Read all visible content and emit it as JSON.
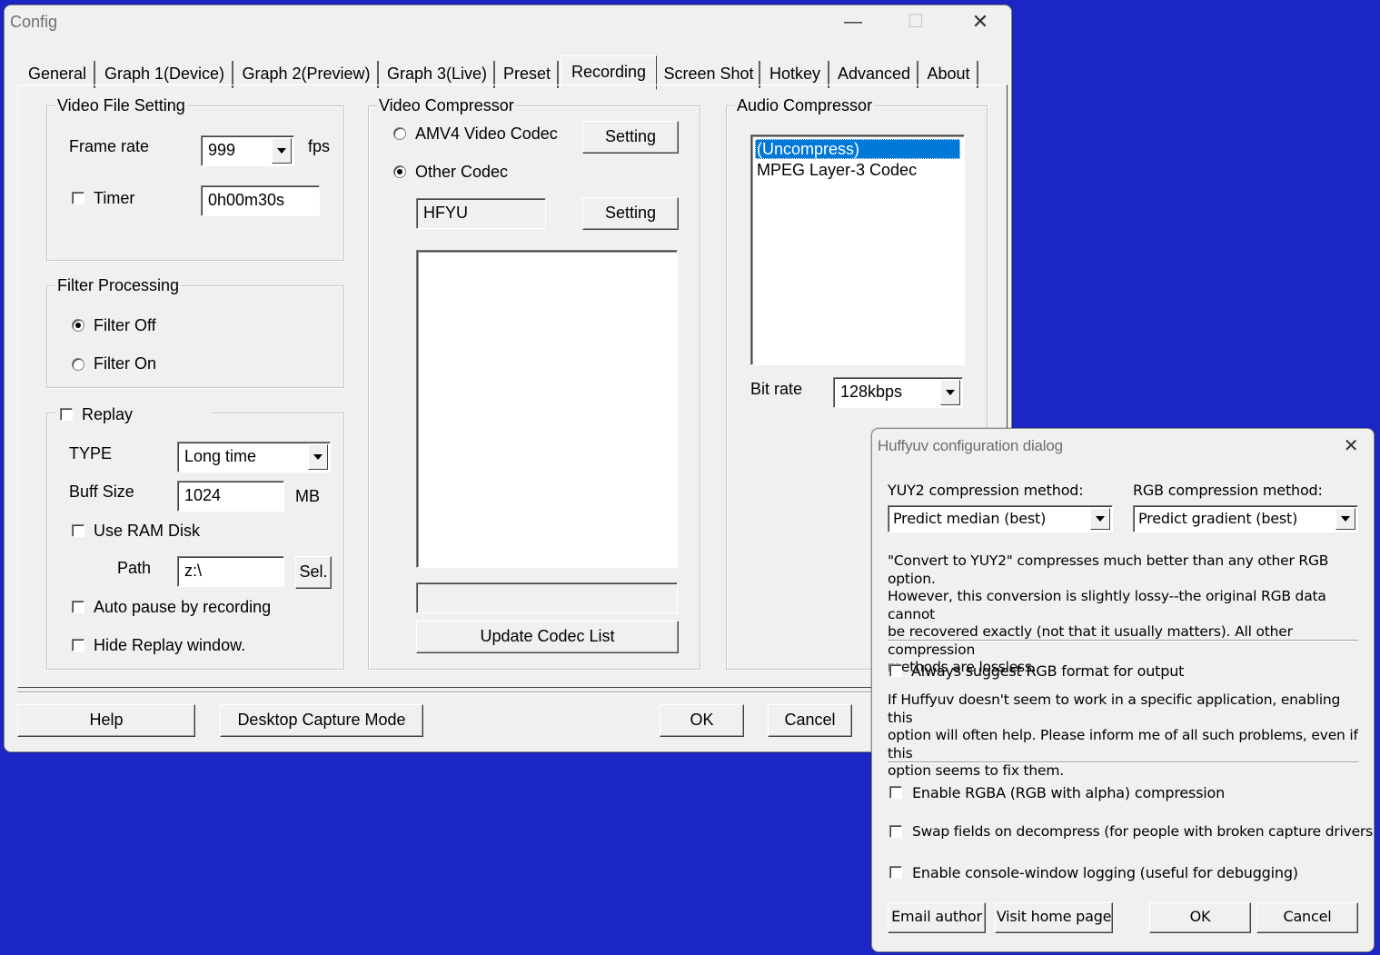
{
  "config": {
    "title": "Config",
    "tabs": [
      "General",
      "Graph 1(Device)",
      "Graph 2(Preview)",
      "Graph 3(Live)",
      "Preset",
      "Recording",
      "Screen Shot",
      "Hotkey",
      "Advanced",
      "About"
    ],
    "active_tab": "Recording",
    "video_file": {
      "legend": "Video File Setting",
      "frame_rate_label": "Frame rate",
      "frame_rate_value": "999",
      "fps_label": "fps",
      "timer_label": "Timer",
      "timer_checked": false,
      "timer_value": "0h00m30s"
    },
    "filter": {
      "legend": "Filter Processing",
      "off_label": "Filter Off",
      "on_label": "Filter On",
      "selected": "off"
    },
    "replay": {
      "legend": "Replay",
      "checked": false,
      "type_label": "TYPE",
      "type_value": "Long time",
      "buff_label": "Buff Size",
      "buff_value": "1024",
      "buff_unit": "MB",
      "ram_disk_label": "Use RAM Disk",
      "path_label": "Path",
      "path_value": "z:\\",
      "sel_label": "Sel.",
      "auto_pause_label": "Auto pause by recording",
      "hide_window_label": "Hide Replay window."
    },
    "video_compressor": {
      "legend": "Video Compressor",
      "amv4_label": "AMV4 Video Codec",
      "other_label": "Other Codec",
      "selected": "other",
      "setting1_label": "Setting",
      "setting2_label": "Setting",
      "codec_value": "HFYU",
      "status_value": "",
      "update_label": "Update Codec List"
    },
    "audio_compressor": {
      "legend": "Audio Compressor",
      "items": [
        "(Uncompress)",
        "MPEG Layer-3 Codec"
      ],
      "selected_index": 0,
      "bitrate_label": "Bit rate",
      "bitrate_value": "128kbps"
    },
    "buttons": {
      "help": "Help",
      "desktop_capture": "Desktop Capture Mode",
      "ok": "OK",
      "cancel": "Cancel"
    }
  },
  "huffyuv": {
    "title": "Huffyuv configuration dialog",
    "yuy2_label": "YUY2 compression method:",
    "yuy2_value": "Predict median (best)",
    "rgb_label": "RGB compression method:",
    "rgb_value": "Predict gradient (best)",
    "desc1_lines": [
      "\"Convert to YUY2\" compresses much better than any other RGB option.",
      "However, this conversion is slightly lossy--the original RGB data cannot",
      "be recovered exactly (not that it usually matters).  All other compression",
      "methods are lossless."
    ],
    "suggest_rgb_label": "Always suggest RGB format for output",
    "desc2_lines": [
      "If Huffyuv doesn't seem to work in a specific application, enabling this",
      "option will often help.  Please inform me of all such problems, even if this",
      "option seems to fix them."
    ],
    "rgba_label": "Enable RGBA (RGB with alpha) compression",
    "swap_label": "Swap fields on decompress (for people with broken capture drivers)",
    "console_label": "Enable console-window logging (useful for debugging)",
    "buttons": {
      "email": "Email author",
      "home": "Visit home page",
      "ok": "OK",
      "cancel": "Cancel"
    }
  }
}
